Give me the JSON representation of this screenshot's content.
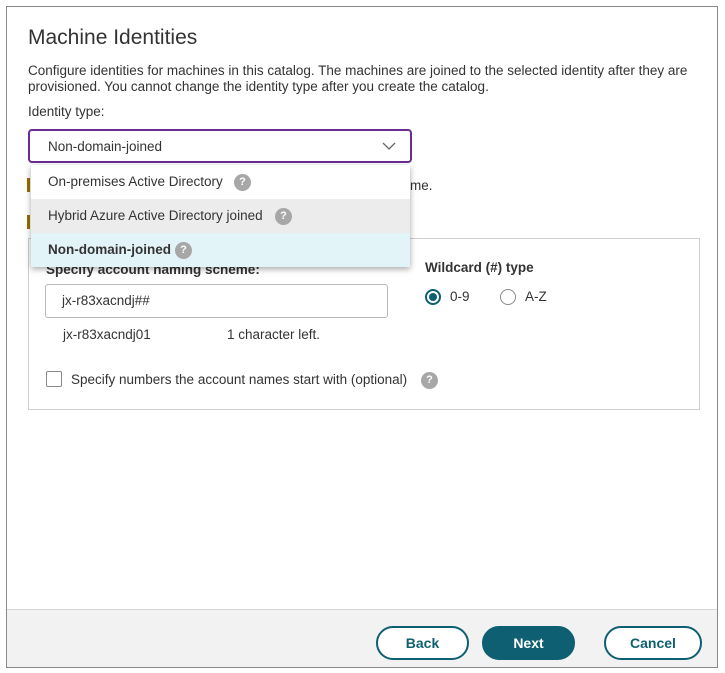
{
  "page": {
    "title": "Machine Identities",
    "description": "Configure identities for machines in this catalog. The machines are joined to the selected identity after they are provisioned. You cannot change the identity type after you create the catalog.",
    "identity_type_label": "Identity type:"
  },
  "identity_select": {
    "value": "Non-domain-joined",
    "options": [
      {
        "label": "On-premises Active Directory",
        "state": "normal"
      },
      {
        "label": "Hybrid Azure Active Directory joined",
        "state": "hover"
      },
      {
        "label": "Non-domain-joined",
        "state": "selected"
      }
    ]
  },
  "hidden_text_fragment": "me.",
  "account_naming": {
    "header": "Specify account naming scheme:",
    "value": "jx-r83xacndj##",
    "preview": "jx-r83xacndj01",
    "chars_left": "1 character left."
  },
  "wildcard": {
    "label": "Wildcard (#) type",
    "options": [
      {
        "label": "0-9",
        "checked": true
      },
      {
        "label": "A-Z",
        "checked": false
      }
    ]
  },
  "start_numbers": {
    "label": "Specify numbers the account names start with (optional)",
    "checked": false
  },
  "help_glyph": "?",
  "footer": {
    "back": "Back",
    "next": "Next",
    "cancel": "Cancel"
  },
  "colors": {
    "accent": "#0f5f73",
    "select_border": "#6a2d91",
    "selected_option_bg": "#e3f4f8"
  }
}
